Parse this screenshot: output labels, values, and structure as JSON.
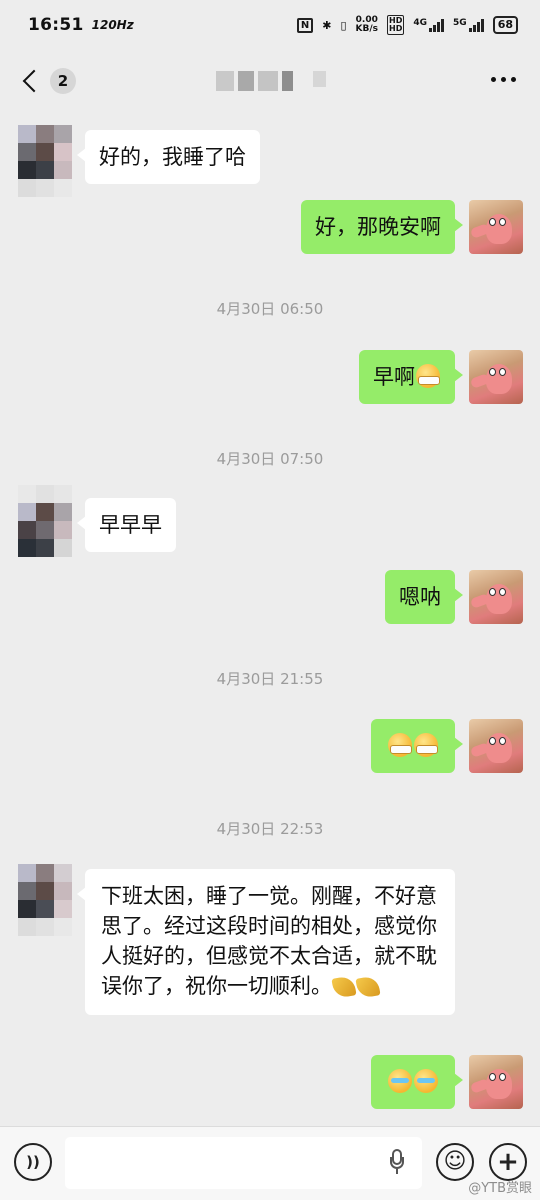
{
  "status_bar": {
    "time": "16:51",
    "refresh_rate": "120Hz",
    "nfc": "N",
    "net_speed": "0.00",
    "net_unit": "KB/s",
    "network": "4G",
    "network2": "5G",
    "battery": "68"
  },
  "nav": {
    "unread_count": "2"
  },
  "messages": [
    {
      "side": "in",
      "text": "好的，我睡了哈"
    },
    {
      "side": "out",
      "text": "好，那晚安啊"
    },
    {
      "side": "time",
      "text": "4月30日 06:50"
    },
    {
      "side": "out",
      "text": "早啊",
      "emoji": [
        "mask"
      ]
    },
    {
      "side": "time",
      "text": "4月30日 07:50"
    },
    {
      "side": "in",
      "text": "早早早"
    },
    {
      "side": "out",
      "text": "嗯呐"
    },
    {
      "side": "time",
      "text": "4月30日 21:55"
    },
    {
      "side": "out",
      "text": "",
      "emoji": [
        "mask",
        "mask"
      ]
    },
    {
      "side": "time",
      "text": "4月30日 22:53"
    },
    {
      "side": "in",
      "text": "下班太困，睡了一觉。刚醒，不好意思了。经过这段时间的相处，感觉你人挺好的，但感觉不太合适，就不耽误你了，祝你一切顺利。",
      "emoji": [
        "pray",
        "pray"
      ]
    },
    {
      "side": "out",
      "text": "",
      "emoji": [
        "tear",
        "tear"
      ]
    }
  ],
  "input": {
    "placeholder": ""
  },
  "watermark": "@YTB赏眼",
  "icons": {
    "voice": "voice-icon",
    "emoji": "emoji-icon",
    "plus": "plus-icon",
    "mic": "mic-icon",
    "back": "back-chevron-icon",
    "more": "more-icon"
  }
}
